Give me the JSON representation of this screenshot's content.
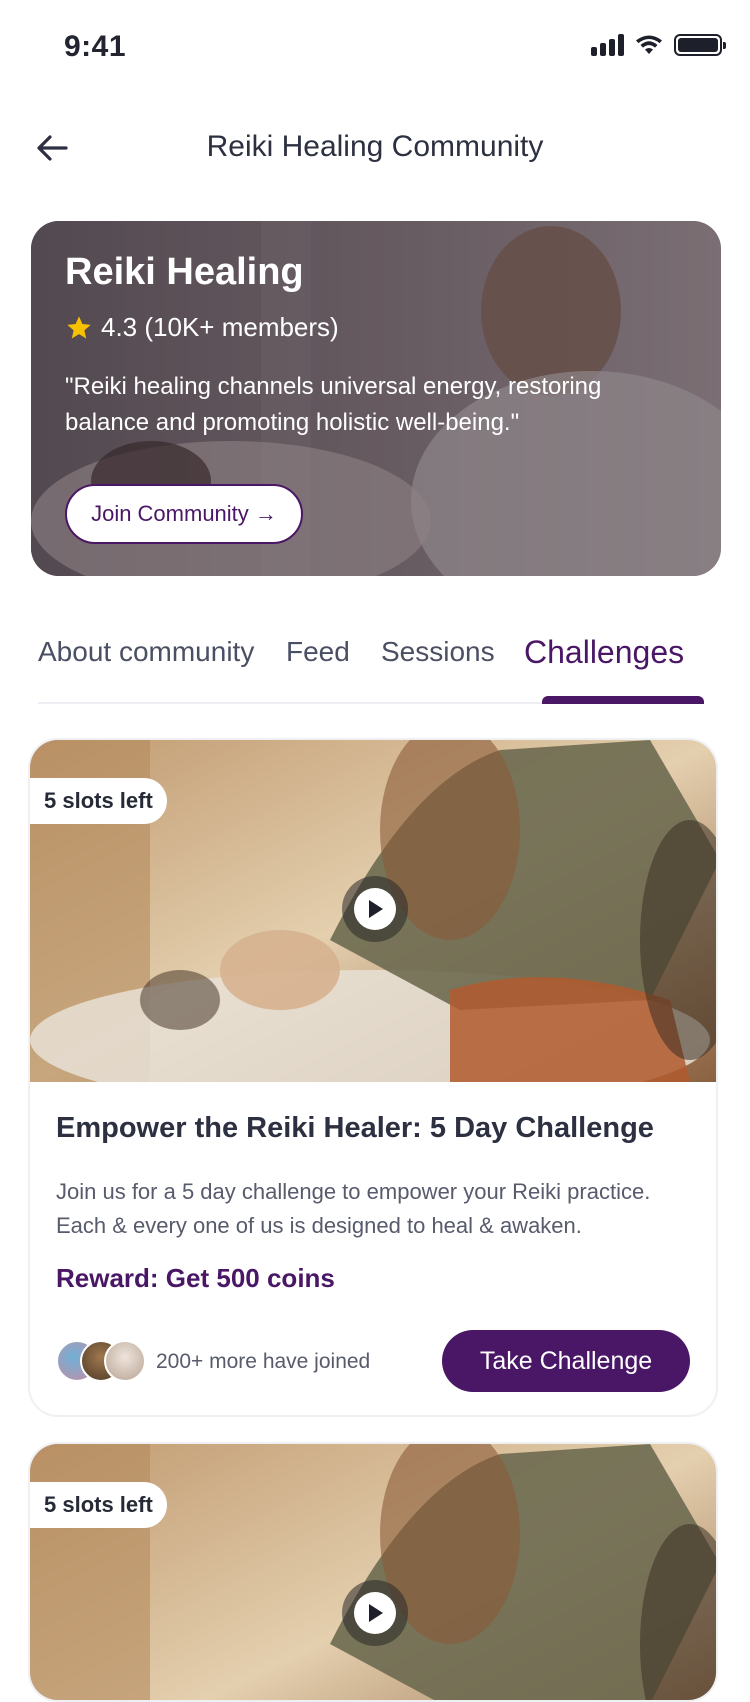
{
  "status_bar": {
    "time": "9:41"
  },
  "header": {
    "title": "Reiki Healing Community"
  },
  "hero": {
    "title": "Reiki Healing",
    "rating": "4.3 (10K+ members)",
    "quote": "\"Reiki healing channels universal energy, restoring balance and promoting holistic well-being.\"",
    "join_label": "Join Community →"
  },
  "tabs": [
    {
      "label": "About community",
      "active": false
    },
    {
      "label": "Feed",
      "active": false
    },
    {
      "label": "Sessions",
      "active": false
    },
    {
      "label": "Challenges",
      "active": true
    }
  ],
  "challenges": [
    {
      "slots": "5 slots left",
      "title": "Empower the Reiki Healer: 5 Day Challenge",
      "description": "Join us for a 5 day challenge to empower your Reiki practice. Each & every one of us is designed to heal & awaken.",
      "reward": "Reward: Get 500 coins",
      "joined": "200+ more have joined",
      "cta": "Take Challenge"
    },
    {
      "slots": "5 slots left"
    }
  ],
  "colors": {
    "accent": "#4a1766",
    "star": "#f6c200"
  },
  "icons": {
    "back": "arrow-left-icon",
    "star": "star-icon",
    "play": "play-icon",
    "signal": "signal-icon",
    "wifi": "wifi-icon",
    "battery": "battery-icon"
  }
}
